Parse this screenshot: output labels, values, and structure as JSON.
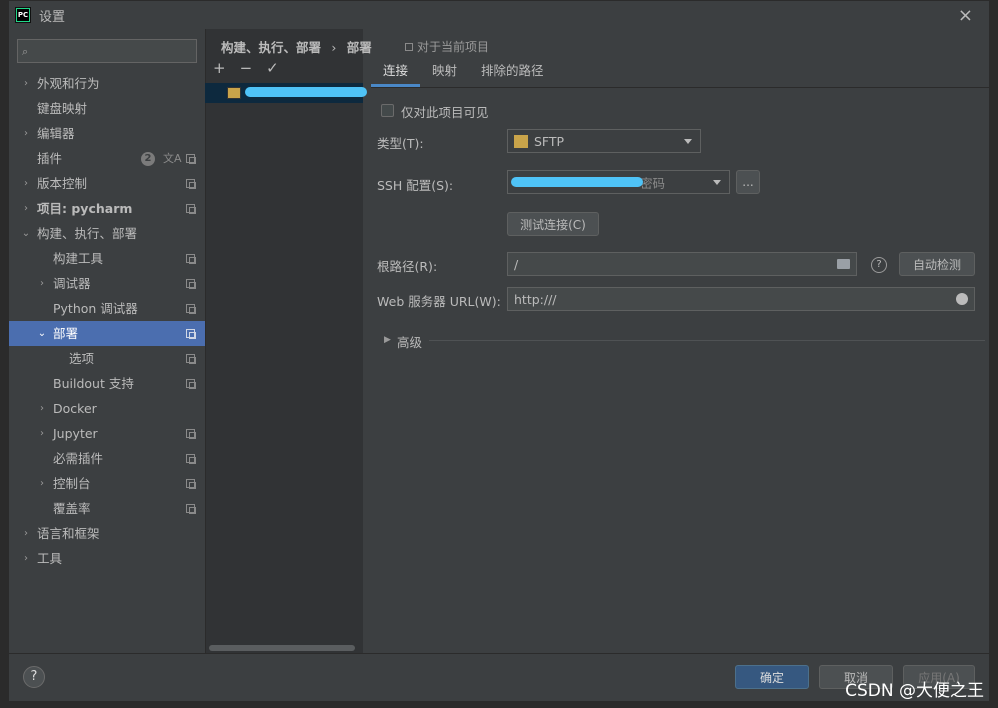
{
  "window": {
    "title": "设置",
    "close_glyph": "×"
  },
  "search": {
    "placeholder": ""
  },
  "nav": [
    {
      "label": "外观和行为",
      "arrow": "›",
      "indent": 1
    },
    {
      "label": "键盘映射",
      "arrow": "",
      "indent": 1
    },
    {
      "label": "编辑器",
      "arrow": "›",
      "indent": 1
    },
    {
      "label": "插件",
      "arrow": "",
      "indent": 1,
      "badge": "2",
      "translate": "文A"
    },
    {
      "label": "版本控制",
      "arrow": "›",
      "indent": 1
    },
    {
      "label": "项目: pycharm",
      "arrow": "›",
      "indent": 1,
      "bold": true
    },
    {
      "label": "构建、执行、部署",
      "arrow": "⌄",
      "indent": 1
    },
    {
      "label": "构建工具",
      "arrow": "",
      "indent": 2
    },
    {
      "label": "调试器",
      "arrow": "›",
      "indent": 2
    },
    {
      "label": "Python 调试器",
      "arrow": "",
      "indent": 2
    },
    {
      "label": "部署",
      "arrow": "⌄",
      "indent": 2,
      "selected": true
    },
    {
      "label": "选项",
      "arrow": "",
      "indent": 3
    },
    {
      "label": "Buildout 支持",
      "arrow": "",
      "indent": 2
    },
    {
      "label": "Docker",
      "arrow": "›",
      "indent": 2
    },
    {
      "label": "Jupyter",
      "arrow": "›",
      "indent": 2
    },
    {
      "label": "必需插件",
      "arrow": "",
      "indent": 2
    },
    {
      "label": "控制台",
      "arrow": "›",
      "indent": 2
    },
    {
      "label": "覆盖率",
      "arrow": "",
      "indent": 2
    },
    {
      "label": "语言和框架",
      "arrow": "›",
      "indent": 1
    },
    {
      "label": "工具",
      "arrow": "›",
      "indent": 1
    }
  ],
  "breadcrumb": {
    "parent": "构建、执行、部署",
    "sep": "›",
    "current": "部署"
  },
  "scope_label": "对于当前项目",
  "toolbar": {
    "add": "+",
    "remove": "−",
    "check": "✓"
  },
  "tabs": [
    "连接",
    "映射",
    "排除的路径"
  ],
  "visible_only_label": "仅对此项目可见",
  "form": {
    "type_label": "类型(T):",
    "type_value": "SFTP",
    "ssh_label": "SSH 配置(S):",
    "ssh_value_suffix": "密码",
    "ssh_more": "...",
    "test_button": "测试连接(C)",
    "root_label": "根路径(R):",
    "root_value": "/",
    "help": "?",
    "autodetect_button": "自动检测",
    "web_label": "Web 服务器 URL(W):",
    "web_value": "http:///",
    "advanced_label": "高级"
  },
  "footer": {
    "help": "?",
    "ok": "确定",
    "cancel": "取消",
    "apply": "应用(A)"
  },
  "watermark": "CSDN @大便之王"
}
